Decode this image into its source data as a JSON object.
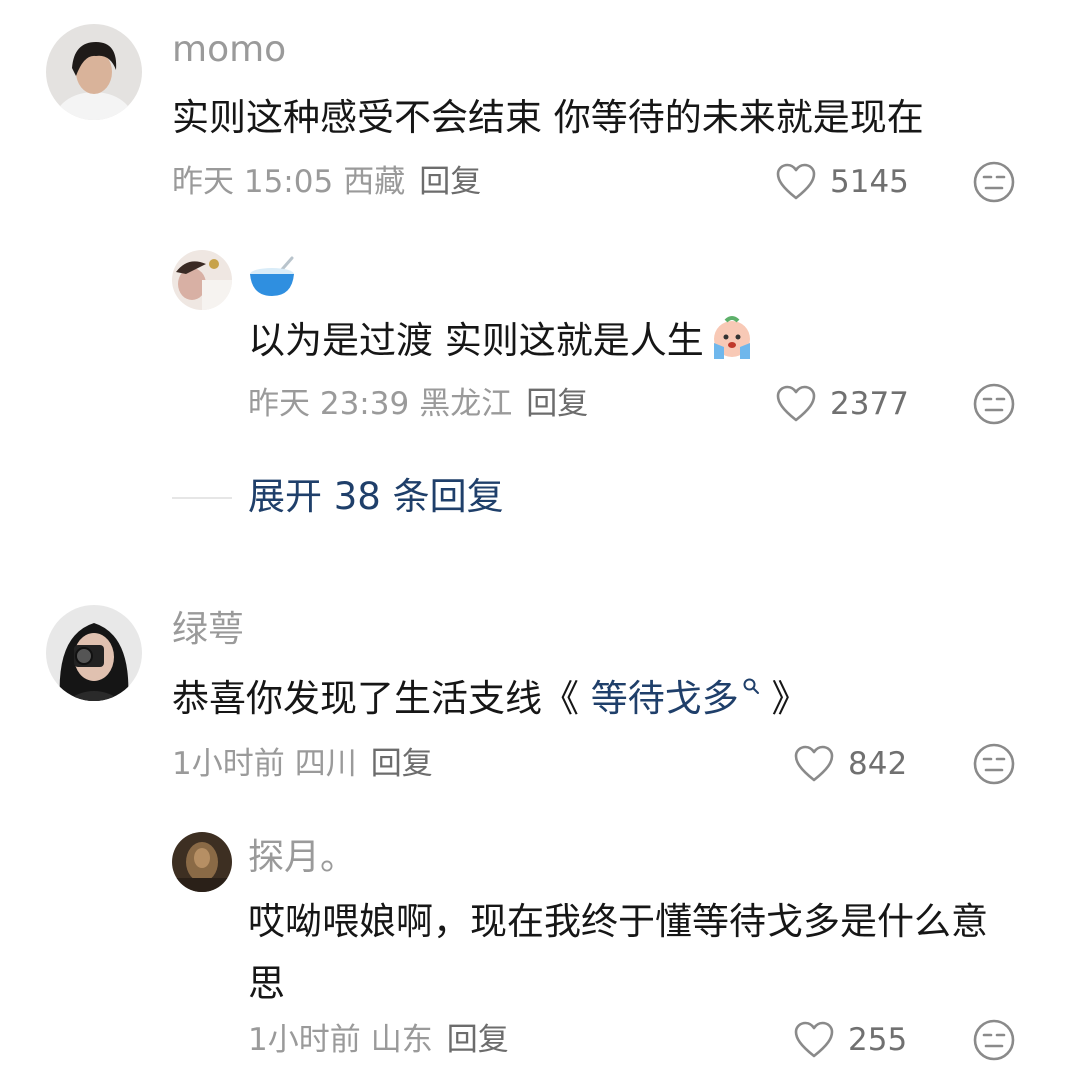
{
  "comments": [
    {
      "username": "momo",
      "content": "实则这种感受不会结束 你等待的未来就是现在",
      "time": "昨天 15:05",
      "location": "西藏",
      "reply_label": "回复",
      "likes": "5145",
      "replies": [
        {
          "username": "",
          "username_icon": "bowl-spoon-emoji",
          "content": "以为是过渡 实则这就是人生",
          "content_emoji": "crying-face-emoji",
          "time": "昨天 23:39",
          "location": "黑龙江",
          "reply_label": "回复",
          "likes": "2377"
        }
      ],
      "expand_label": "展开 38 条回复"
    },
    {
      "username": "绿萼",
      "content_prefix": "恭喜你发现了生活支线《",
      "content_link": "等待戈多",
      "content_link_icon": "search-icon",
      "content_suffix": "》",
      "time": "1小时前",
      "location": "四川",
      "reply_label": "回复",
      "likes": "842",
      "replies": [
        {
          "username": "探月。",
          "content": "哎呦喂娘啊，现在我终于懂等待戈多是什么意思",
          "time": "1小时前",
          "location": "山东",
          "reply_label": "回复",
          "likes": "255"
        }
      ]
    }
  ],
  "colors": {
    "link": "#1f3f6a",
    "meta": "#9a9a9a",
    "text": "#161616"
  }
}
